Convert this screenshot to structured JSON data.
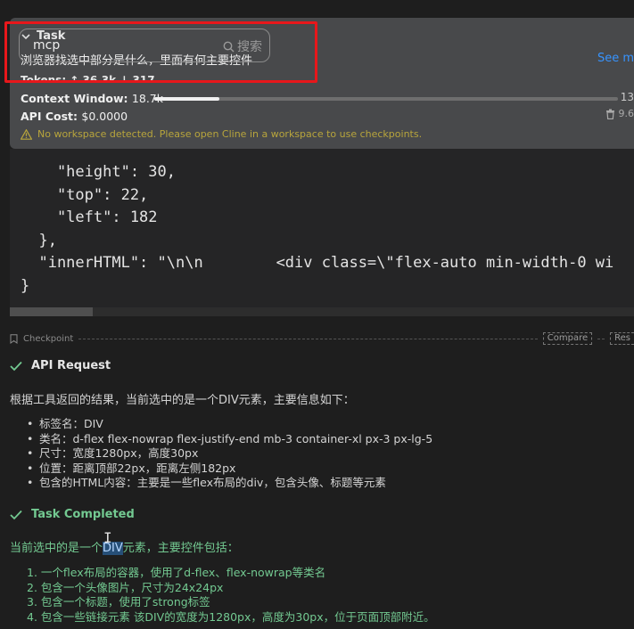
{
  "task": {
    "title": "Task",
    "search": {
      "value": "mcp",
      "placeholder": "搜索"
    },
    "text": "浏览器找选中部分是什么，里面有何主要控件",
    "see_more": "See m",
    "tokens": "Tokens: ↑ 36.3k ↓ 317",
    "context_window_label": "Context Window:",
    "context_window_value": "18.7k",
    "context_window_max": "13",
    "context_fraction": 0.14,
    "api_cost_label": "API Cost:",
    "api_cost_value": "$0.0000",
    "storage": "9.6",
    "warning": "No workspace detected. Please open Cline in a workspace to use checkpoints."
  },
  "code": {
    "lines": [
      "    \"height\": 30,",
      "    \"top\": 22,",
      "    \"left\": 182",
      "  },",
      "  \"innerHTML\": \"\\n\\n        <div class=\\\"flex-auto min-width-0 wi",
      "}"
    ]
  },
  "checkpoint": {
    "label": "Checkpoint",
    "compare": "Compare",
    "restore": "Res"
  },
  "api_request": {
    "title": "API Request",
    "intro": "根据工具返回的结果，当前选中的是一个DIV元素，主要信息如下：",
    "bullets": [
      "标签名：DIV",
      "类名：d-flex flex-nowrap flex-justify-end mb-3 container-xl px-3 px-lg-5",
      "尺寸：宽度1280px，高度30px",
      "位置：距离顶部22px，距离左侧182px",
      "包含的HTML内容：主要是一些flex布局的div，包含头像、标题等元素"
    ]
  },
  "task_completed": {
    "title": "Task Completed",
    "intro_before": "当前选中的是一个",
    "intro_highlight": "DIV",
    "intro_after": "元素，主要控件包括：",
    "items": [
      "1. 一个flex布局的容器，使用了d-flex、flex-nowrap等类名",
      "2. 包含一个头像图片，尺寸为24x24px",
      "3. 包含一个标题，使用了strong标签",
      "4. 包含一些链接元素 该DIV的宽度为1280px，高度为30px，位于页面顶部附近。"
    ]
  },
  "colors": {
    "panel_bg": "#48494b",
    "highlight_box": "#e8171b",
    "success_green": "#73c991",
    "warning_yellow": "#b8a53c",
    "link_blue": "#3794ff"
  }
}
